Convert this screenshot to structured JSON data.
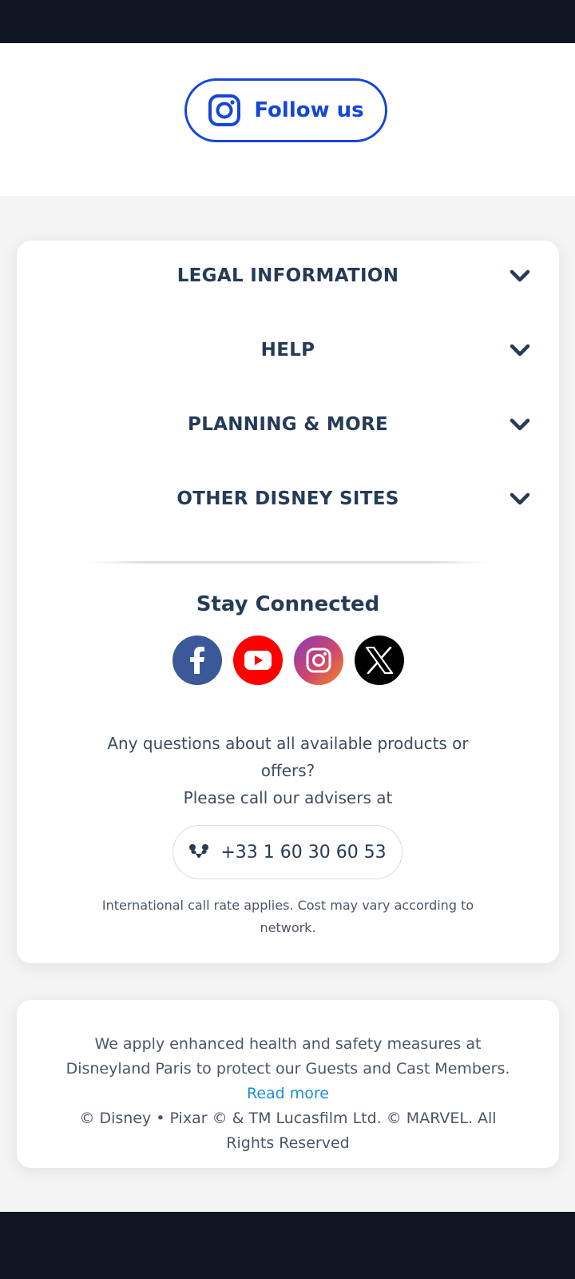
{
  "follow": {
    "label": "Follow us",
    "icon": "instagram-icon",
    "color": "#1546d4"
  },
  "accordion": [
    {
      "label": "LEGAL INFORMATION",
      "icon": "chevron-down-icon"
    },
    {
      "label": "HELP",
      "icon": "chevron-down-icon"
    },
    {
      "label": "PLANNING & MORE",
      "icon": "chevron-down-icon"
    },
    {
      "label": "OTHER DISNEY SITES",
      "icon": "chevron-down-icon"
    }
  ],
  "stay_connected": {
    "title": "Stay Connected",
    "socials": [
      {
        "name": "facebook-icon",
        "color": "#3b5998"
      },
      {
        "name": "youtube-icon",
        "color": "#ff0000"
      },
      {
        "name": "instagram-icon",
        "color": "#c13584"
      },
      {
        "name": "x-icon",
        "color": "#000000"
      }
    ]
  },
  "contact": {
    "question_line1": "Any questions about all available products or",
    "question_line2": "offers?",
    "call_line": "Please call our advisers at",
    "phone_icon": "mickey-phone-icon",
    "phone": "+33 1 60 30 60 53",
    "note": "International call rate applies. Cost may vary according to network."
  },
  "footer": {
    "health_text": "We apply enhanced health and safety measures at Disneyland Paris to protect our Guests and Cast Members.",
    "read_more": "Read more",
    "copyright": "© Disney • Pixar © & TM Lucasfilm Ltd. © MARVEL. All Rights Reserved",
    "link_color": "#1a8ed8"
  }
}
